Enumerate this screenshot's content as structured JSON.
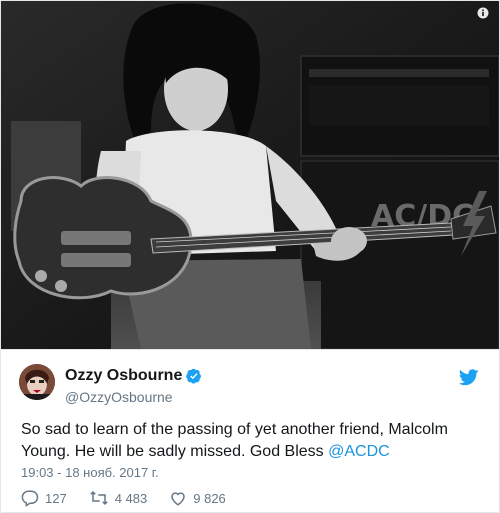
{
  "tweet": {
    "display_name": "Ozzy Osbourne",
    "handle": "@OzzyOsbourne",
    "text_main": "So sad to learn of the passing of yet another friend, Malcolm Young. He will be sadly missed. God Bless ",
    "text_mention": "@ACDC",
    "timestamp": "19:03 - 18 нояб. 2017 г.",
    "verified": true
  },
  "actions": {
    "replies": "127",
    "retweets": "4 483",
    "likes": "9 826"
  },
  "amp_lettering": "AC/DC",
  "colors": {
    "link": "#1b95e0",
    "twitter_bird": "#1da1f2",
    "secondary_text": "#657786",
    "border": "#e1e8ed"
  },
  "icons": {
    "info": "info-icon",
    "verified": "verified-badge-icon",
    "bird": "twitter-bird-icon",
    "reply": "reply-icon",
    "retweet": "retweet-icon",
    "like": "heart-icon"
  }
}
